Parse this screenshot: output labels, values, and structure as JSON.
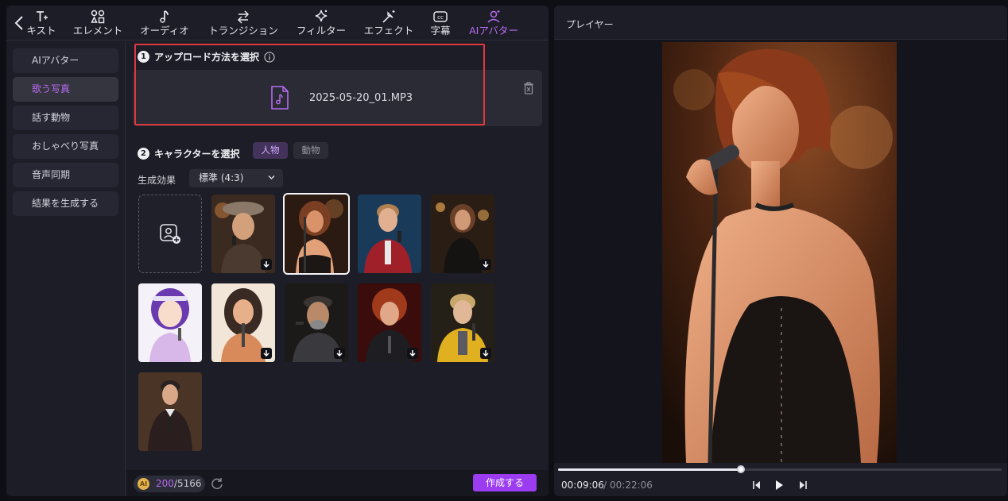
{
  "toolbar": {
    "items": [
      {
        "label": "キスト",
        "icon": "text-icon"
      },
      {
        "label": "エレメント",
        "icon": "elements-icon"
      },
      {
        "label": "オーディオ",
        "icon": "music-note-icon"
      },
      {
        "label": "トランジション",
        "icon": "transition-arrows-icon"
      },
      {
        "label": "フィルター",
        "icon": "sparkle-icon"
      },
      {
        "label": "エフェクト",
        "icon": "magic-wand-icon"
      },
      {
        "label": "字幕",
        "icon": "cc-icon"
      },
      {
        "label": "AIアバター",
        "icon": "avatar-icon",
        "active": true
      }
    ]
  },
  "sidebar": {
    "items": [
      {
        "label": "AIアバター"
      },
      {
        "label": "歌う写真",
        "active": true
      },
      {
        "label": "話す動物"
      },
      {
        "label": "おしゃべり写真"
      },
      {
        "label": "音声同期"
      },
      {
        "label": "結果を生成する"
      }
    ]
  },
  "step1": {
    "num": "1",
    "title": "アップロード方法を選択",
    "file_name": "2025-05-20_01.MP3"
  },
  "step2": {
    "num": "2",
    "title": "キャラクターを選択",
    "chip_human": "人物",
    "chip_animal": "動物"
  },
  "effect": {
    "label": "生成効果",
    "value": "標準 (4:3)"
  },
  "footer": {
    "credits_used": "200",
    "credits_total": "/5166",
    "coin": "AI",
    "create_label": "作成する"
  },
  "player": {
    "title": "プレイヤー",
    "time_current": "00:09:06",
    "time_separator": "/",
    "time_total": "00:22:06",
    "progress": 0.412
  },
  "colors": {
    "accent": "#9b3cf0",
    "active_text": "#b76cf2",
    "highlight_frame": "#e0383e"
  }
}
